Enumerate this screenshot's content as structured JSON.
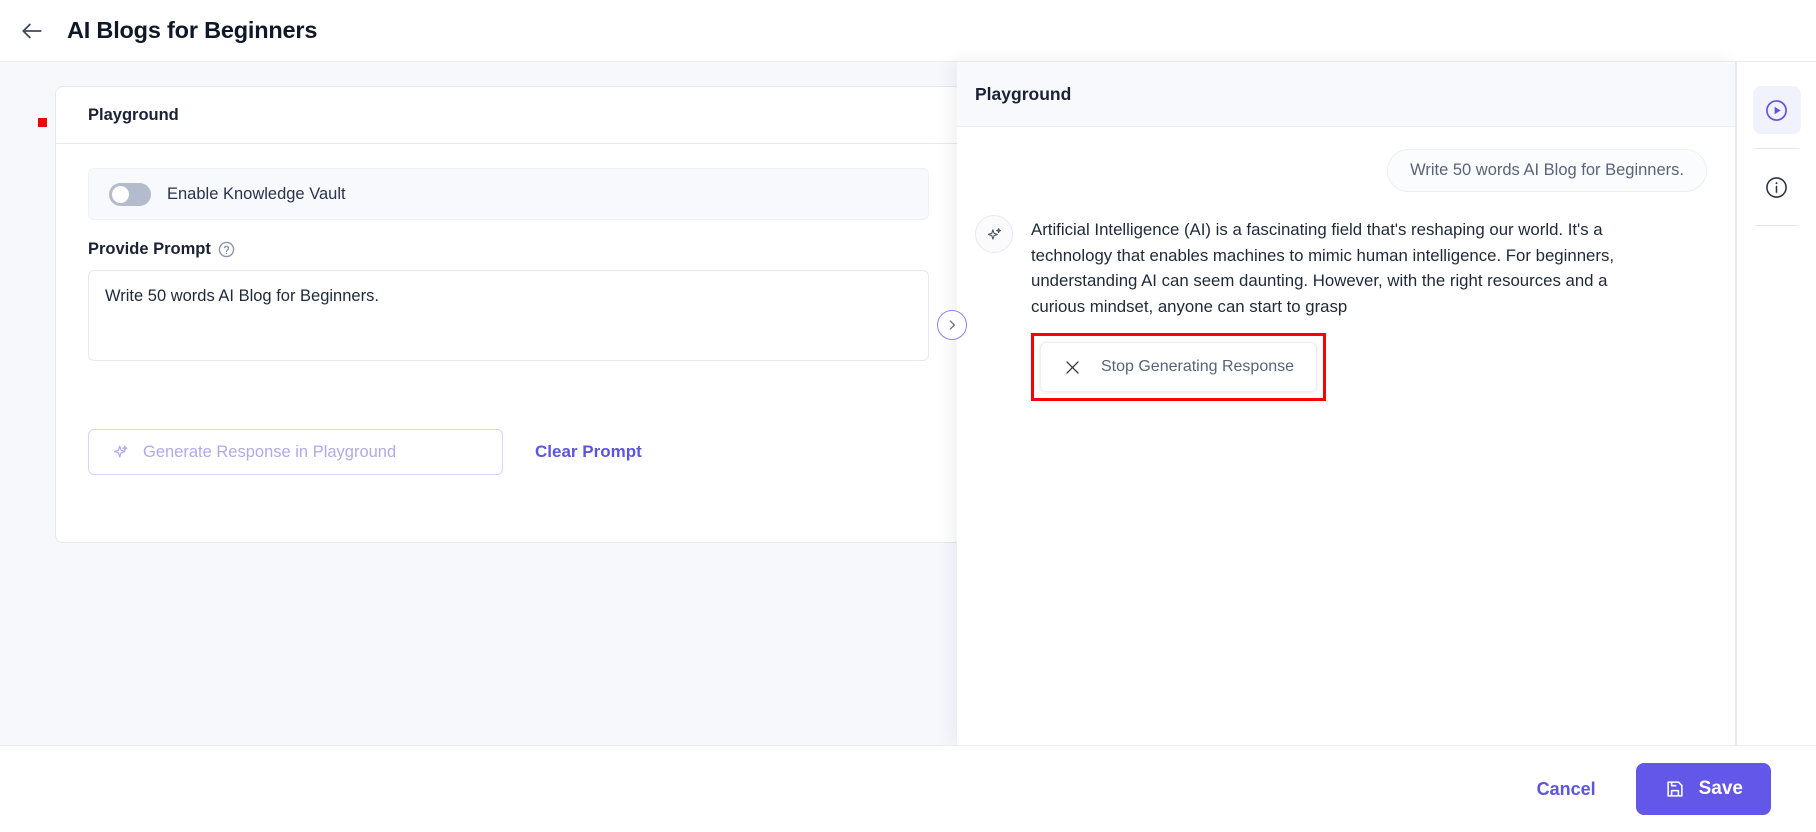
{
  "header": {
    "back_icon": "arrow-left-icon",
    "title": "AI Blogs for Beginners"
  },
  "left_panel": {
    "card_title": "Playground",
    "knowledge_vault": {
      "label": "Enable Knowledge Vault",
      "enabled": false
    },
    "prompt_field": {
      "label": "Provide Prompt",
      "help_icon": "question-circle-icon",
      "value": "Write 50 words AI Blog for Beginners.",
      "placeholder": "Provide Prompt"
    },
    "generate_button": {
      "label": "Generate Response in Playground",
      "icon": "sparkle-icon",
      "disabled": true
    },
    "clear_button": {
      "label": "Clear Prompt"
    }
  },
  "overlay_panel": {
    "title": "Playground",
    "collapse_icon": "chevron-right-icon",
    "user_message": "Write 50 words AI Blog for Beginners.",
    "assistant_avatar_icon": "sparkle-icon",
    "assistant_message": "Artificial Intelligence (AI) is a fascinating field that's reshaping our world. It's a technology that enables machines to mimic human intelligence. For beginners, understanding AI can seem daunting. However, with the right resources and a curious mindset, anyone can start to grasp",
    "stop_button": {
      "label": "Stop Generating Response",
      "icon": "close-x-icon",
      "highlight_color": "#fe0000"
    }
  },
  "right_rail": {
    "items": [
      {
        "name": "playground",
        "icon": "play-circle-icon",
        "active": true
      },
      {
        "name": "info",
        "icon": "info-circle-icon",
        "active": false
      }
    ]
  },
  "footer": {
    "cancel_label": "Cancel",
    "save_label": "Save",
    "save_icon": "save-disk-icon"
  },
  "colors": {
    "accent": "#6257e8",
    "accent_text": "#5b55e0",
    "canvas_bg": "#f7f8fc",
    "marker_red": "#f40000"
  }
}
